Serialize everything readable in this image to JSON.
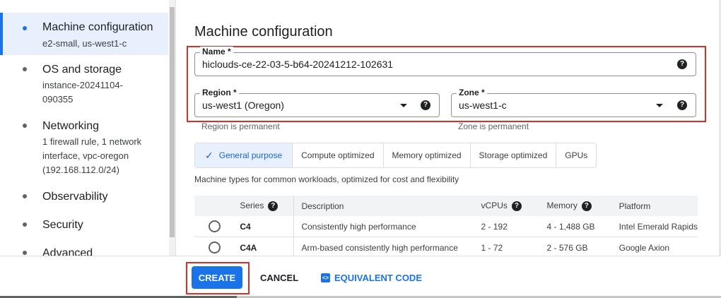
{
  "nav": {
    "items": [
      {
        "title": "Machine configuration",
        "subtitle_lines": [
          "e2-small, us-west1-c"
        ]
      },
      {
        "title": "OS and storage",
        "subtitle_lines": [
          "instance-20241104-",
          "090355"
        ]
      },
      {
        "title": "Networking",
        "subtitle_lines": [
          "1 firewall rule, 1 network",
          "interface, vpc-oregon",
          "(192.168.112.0/24)"
        ]
      },
      {
        "title": "Observability",
        "subtitle_lines": []
      },
      {
        "title": "Security",
        "subtitle_lines": []
      },
      {
        "title": "Advanced",
        "subtitle_lines": []
      }
    ]
  },
  "main": {
    "heading": "Machine configuration",
    "name_field": {
      "label": "Name *",
      "value": "hiclouds-ce-22-03-5-b64-20241212-102631"
    },
    "region_field": {
      "label": "Region *",
      "value": "us-west1 (Oregon)",
      "hint": "Region is permanent"
    },
    "zone_field": {
      "label": "Zone *",
      "value": "us-west1-c",
      "hint": "Zone is permanent"
    },
    "tabs": [
      "General purpose",
      "Compute optimized",
      "Memory optimized",
      "Storage optimized",
      "GPUs"
    ],
    "tab_check": "✓",
    "description": "Machine types for common workloads, optimized for cost and flexibility",
    "table": {
      "columns": [
        "Series",
        "Description",
        "vCPUs",
        "Memory",
        "Platform"
      ],
      "rows": [
        [
          "C4",
          "Consistently high performance",
          "2 - 192",
          "4 - 1,488 GB",
          "Intel Emerald Rapids"
        ],
        [
          "C4A",
          "Arm-based consistently high performance",
          "1 - 72",
          "2 - 576 GB",
          "Google Axion"
        ]
      ]
    }
  },
  "help_glyph": "?",
  "code_glyph": "<>",
  "footer": {
    "create": "CREATE",
    "cancel": "CANCEL",
    "equivalent_code": "EQUIVALENT CODE"
  },
  "colors": {
    "accent": "#1a73e8",
    "highlight": "#d93025"
  }
}
